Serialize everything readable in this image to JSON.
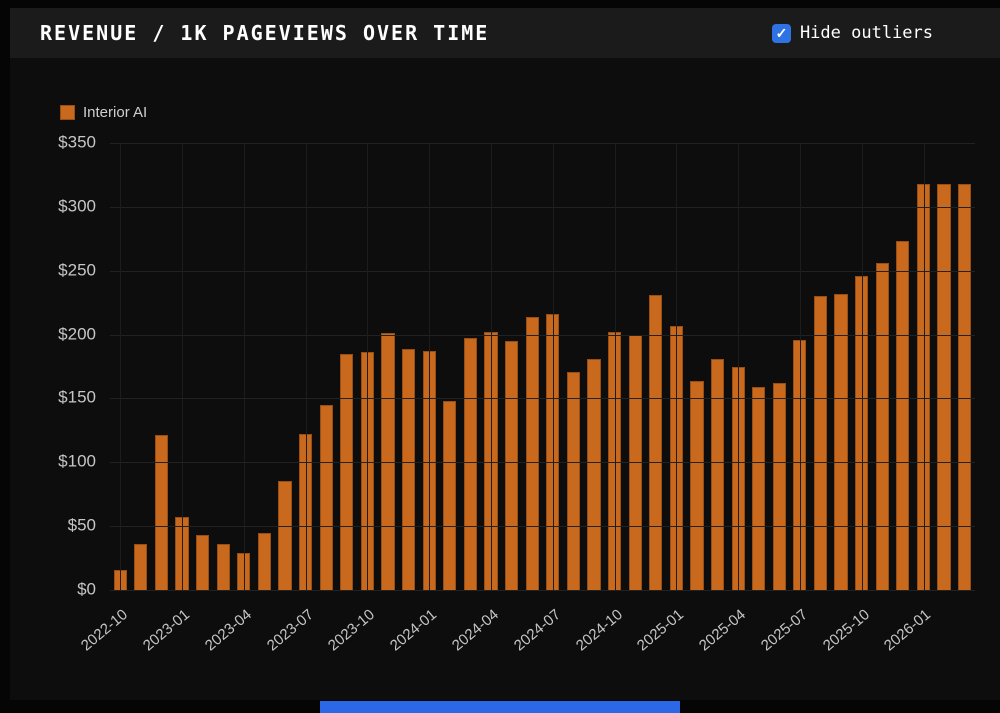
{
  "header": {
    "title": "REVENUE / 1K PAGEVIEWS OVER TIME",
    "toggle_label": "Hide outliers",
    "toggle_checked": true,
    "checkmark": "✓"
  },
  "colors": {
    "checkbox_blue": "#2f72e4",
    "bottom_bar_blue": "#2c67e8",
    "header_bg": "#1b1b1b",
    "panel_bg": "#0d0d0d",
    "axis_text": "#c6c6c6"
  },
  "chart_data": {
    "type": "bar",
    "title": "REVENUE / 1K PAGEVIEWS OVER TIME",
    "xlabel": "",
    "ylabel": "",
    "grid": true,
    "legend_position": "top-left",
    "bar_color": "#c8691e",
    "bar_border_color": "#9a4f12",
    "ylim": [
      0,
      350
    ],
    "y_ticks": [
      0,
      50,
      100,
      150,
      200,
      250,
      300,
      350
    ],
    "y_tick_prefix": "$",
    "x": [
      "2022-10",
      "2022-11",
      "2022-12",
      "2023-01",
      "2023-02",
      "2023-03",
      "2023-04",
      "2023-05",
      "2023-06",
      "2023-07",
      "2023-08",
      "2023-09",
      "2023-10",
      "2023-11",
      "2023-12",
      "2024-01",
      "2024-02",
      "2024-03",
      "2024-04",
      "2024-05",
      "2024-06",
      "2024-07",
      "2024-08",
      "2024-09",
      "2024-10",
      "2024-11",
      "2024-12",
      "2025-01",
      "2025-02",
      "2025-03",
      "2025-04",
      "2025-05",
      "2025-06",
      "2025-07",
      "2025-08",
      "2025-09",
      "2025-10",
      "2025-11",
      "2025-12",
      "2026-01",
      "2026-02",
      "2026-03"
    ],
    "x_tick_labels": [
      "2022-10",
      "2023-01",
      "2023-04",
      "2023-07",
      "2023-10",
      "2024-01",
      "2024-04",
      "2024-07",
      "2024-10",
      "2025-01",
      "2025-04",
      "2025-07",
      "2025-10",
      "2026-01"
    ],
    "series": [
      {
        "name": "Interior AI",
        "values": [
          16,
          36,
          121,
          57,
          43,
          36,
          29,
          45,
          85,
          122,
          145,
          185,
          186,
          201,
          189,
          187,
          148,
          197,
          202,
          195,
          214,
          216,
          171,
          181,
          202,
          200,
          231,
          207,
          164,
          181,
          175,
          159,
          162,
          196,
          230,
          232,
          246,
          256,
          273,
          318,
          318,
          318
        ]
      }
    ]
  }
}
